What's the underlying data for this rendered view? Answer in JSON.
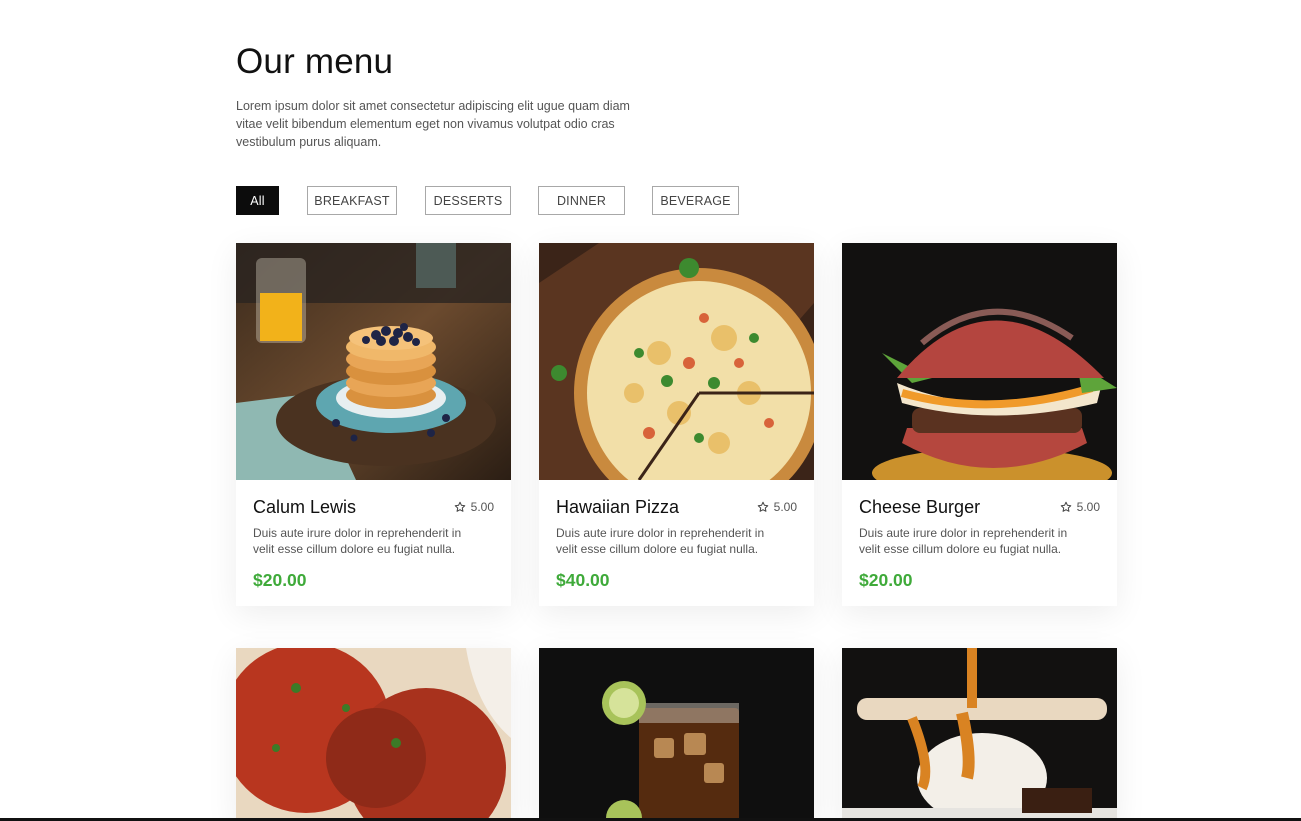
{
  "header": {
    "title": "Our menu",
    "intro": "Lorem ipsum dolor sit amet consectetur adipiscing elit ugue quam diam vitae velit bibendum elementum eget non vivamus volutpat odio cras vestibulum purus aliquam."
  },
  "filters": [
    {
      "label": "All",
      "active": true
    },
    {
      "label": "BREAKFAST",
      "active": false
    },
    {
      "label": "DESSERTS",
      "active": false
    },
    {
      "label": "DINNER",
      "active": false
    },
    {
      "label": "BEVERAGE",
      "active": false
    }
  ],
  "cards": [
    {
      "name": "Calum Lewis",
      "rating": "5.00",
      "desc": "Duis aute irure dolor in reprehenderit in velit esse cillum dolore eu fugiat nulla.",
      "price": "$20.00",
      "image": "pancakes-photo"
    },
    {
      "name": "Hawaiian Pizza",
      "rating": "5.00",
      "desc": "Duis aute irure dolor in reprehenderit in velit esse cillum dolore eu fugiat nulla.",
      "price": "$40.00",
      "image": "pizza-photo"
    },
    {
      "name": "Cheese Burger",
      "rating": "5.00",
      "desc": "Duis aute irure dolor in reprehenderit in velit esse cillum dolore eu fugiat nulla.",
      "price": "$20.00",
      "image": "burger-photo"
    }
  ],
  "row2_images": [
    "meatballs-photo",
    "iced-drink-photo",
    "ice-cream-dessert-photo"
  ],
  "colors": {
    "price": "#3faa3a",
    "active_filter_bg": "#0c0c0c"
  },
  "icons": {
    "rating": "star-outline-icon"
  }
}
